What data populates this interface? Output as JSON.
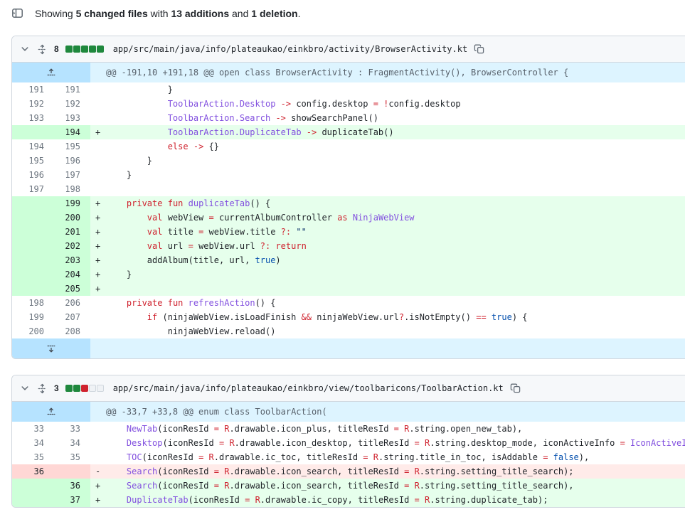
{
  "colors": {
    "border": "#d0d7de",
    "header_bg": "#f6f8fa",
    "add_line_bg": "#e6ffec",
    "add_gutter_bg": "#ccffd8",
    "del_line_bg": "#ffebe9",
    "del_gutter_bg": "#ffd7d5",
    "hunk_line_bg": "#ddf4ff",
    "hunk_gutter_bg": "#b6e3ff",
    "keyword": "#cf222e",
    "entity": "#8250df",
    "constant": "#0550ae",
    "string": "#0a3069",
    "diffstat_add": "#1f883d",
    "diffstat_del": "#cf222e"
  },
  "icons": {
    "file_tree_toggle": "sidebar-expand",
    "chevron": "chevron-down",
    "reorder": "unfold-vertical-arrows",
    "copy": "copy",
    "expand_up": "fold-up-arrow-with-dashes",
    "expand_down": "fold-down-arrow-with-dashes"
  },
  "summary": {
    "segments": [
      {
        "text": "Showing ",
        "bold": false
      },
      {
        "text": "5 changed files",
        "bold": true
      },
      {
        "text": " with ",
        "bold": false
      },
      {
        "text": "13 additions",
        "bold": true
      },
      {
        "text": " and ",
        "bold": false
      },
      {
        "text": "1 deletion",
        "bold": true
      },
      {
        "text": ".",
        "bold": false
      }
    ]
  },
  "files": [
    {
      "count": "8",
      "diffstat": [
        "add",
        "add",
        "add",
        "add",
        "add"
      ],
      "path": "app/src/main/java/info/plateaukao/einkbro/activity/BrowserActivity.kt",
      "hunk": "@@ -191,10 +191,18 @@ open class BrowserActivity : FragmentActivity(), BrowserController {",
      "expand_bottom": true,
      "rows": [
        {
          "t": "context",
          "old": "191",
          "new": "191",
          "seg": [
            [
              "p",
              "            }"
            ]
          ]
        },
        {
          "t": "context",
          "old": "192",
          "new": "192",
          "seg": [
            [
              "p",
              "            "
            ],
            [
              "e",
              "ToolbarAction.Desktop"
            ],
            [
              "p",
              " "
            ],
            [
              "k",
              "->"
            ],
            [
              "p",
              " config.desktop "
            ],
            [
              "k",
              "="
            ],
            [
              "p",
              " "
            ],
            [
              "k",
              "!"
            ],
            [
              "p",
              "config.desktop"
            ]
          ]
        },
        {
          "t": "context",
          "old": "193",
          "new": "193",
          "seg": [
            [
              "p",
              "            "
            ],
            [
              "e",
              "ToolbarAction.Search"
            ],
            [
              "p",
              " "
            ],
            [
              "k",
              "->"
            ],
            [
              "p",
              " showSearchPanel()"
            ]
          ]
        },
        {
          "t": "add",
          "old": "",
          "new": "194",
          "seg": [
            [
              "p",
              "            "
            ],
            [
              "e",
              "ToolbarAction.DuplicateTab"
            ],
            [
              "p",
              " "
            ],
            [
              "k",
              "->"
            ],
            [
              "p",
              " duplicateTab()"
            ]
          ]
        },
        {
          "t": "context",
          "old": "194",
          "new": "195",
          "seg": [
            [
              "p",
              "            "
            ],
            [
              "k",
              "else"
            ],
            [
              "p",
              " "
            ],
            [
              "k",
              "->"
            ],
            [
              "p",
              " {}"
            ]
          ]
        },
        {
          "t": "context",
          "old": "195",
          "new": "196",
          "seg": [
            [
              "p",
              "        }"
            ]
          ]
        },
        {
          "t": "context",
          "old": "196",
          "new": "197",
          "seg": [
            [
              "p",
              "    }"
            ]
          ]
        },
        {
          "t": "context",
          "old": "197",
          "new": "198",
          "seg": []
        },
        {
          "t": "add",
          "old": "",
          "new": "199",
          "seg": [
            [
              "p",
              "    "
            ],
            [
              "k",
              "private"
            ],
            [
              "p",
              " "
            ],
            [
              "k",
              "fun"
            ],
            [
              "p",
              " "
            ],
            [
              "e",
              "duplicateTab"
            ],
            [
              "p",
              "() {"
            ]
          ]
        },
        {
          "t": "add",
          "old": "",
          "new": "200",
          "seg": [
            [
              "p",
              "        "
            ],
            [
              "k",
              "val"
            ],
            [
              "p",
              " webView "
            ],
            [
              "k",
              "="
            ],
            [
              "p",
              " currentAlbumController "
            ],
            [
              "k",
              "as"
            ],
            [
              "p",
              " "
            ],
            [
              "e",
              "NinjaWebView"
            ]
          ]
        },
        {
          "t": "add",
          "old": "",
          "new": "201",
          "seg": [
            [
              "p",
              "        "
            ],
            [
              "k",
              "val"
            ],
            [
              "p",
              " title "
            ],
            [
              "k",
              "="
            ],
            [
              "p",
              " webView.title "
            ],
            [
              "k",
              "?:"
            ],
            [
              "p",
              " "
            ],
            [
              "s",
              "\"\""
            ]
          ]
        },
        {
          "t": "add",
          "old": "",
          "new": "202",
          "seg": [
            [
              "p",
              "        "
            ],
            [
              "k",
              "val"
            ],
            [
              "p",
              " url "
            ],
            [
              "k",
              "="
            ],
            [
              "p",
              " webView.url "
            ],
            [
              "k",
              "?:"
            ],
            [
              "p",
              " "
            ],
            [
              "k",
              "return"
            ]
          ]
        },
        {
          "t": "add",
          "old": "",
          "new": "203",
          "seg": [
            [
              "p",
              "        addAlbum(title, url, "
            ],
            [
              "c",
              "true"
            ],
            [
              "p",
              ")"
            ]
          ]
        },
        {
          "t": "add",
          "old": "",
          "new": "204",
          "seg": [
            [
              "p",
              "    }"
            ]
          ]
        },
        {
          "t": "add",
          "old": "",
          "new": "205",
          "seg": []
        },
        {
          "t": "context",
          "old": "198",
          "new": "206",
          "seg": [
            [
              "p",
              "    "
            ],
            [
              "k",
              "private"
            ],
            [
              "p",
              " "
            ],
            [
              "k",
              "fun"
            ],
            [
              "p",
              " "
            ],
            [
              "e",
              "refreshAction"
            ],
            [
              "p",
              "() {"
            ]
          ]
        },
        {
          "t": "context",
          "old": "199",
          "new": "207",
          "seg": [
            [
              "p",
              "        "
            ],
            [
              "k",
              "if"
            ],
            [
              "p",
              " (ninjaWebView.isLoadFinish "
            ],
            [
              "k",
              "&&"
            ],
            [
              "p",
              " ninjaWebView.url"
            ],
            [
              "k",
              "?"
            ],
            [
              "p",
              ".isNotEmpty() "
            ],
            [
              "k",
              "=="
            ],
            [
              "p",
              " "
            ],
            [
              "c",
              "true"
            ],
            [
              "p",
              ") {"
            ]
          ]
        },
        {
          "t": "context",
          "old": "200",
          "new": "208",
          "seg": [
            [
              "p",
              "            ninjaWebView.reload()"
            ]
          ]
        }
      ]
    },
    {
      "count": "3",
      "diffstat": [
        "add",
        "add",
        "del",
        "neutral",
        "neutral"
      ],
      "path": "app/src/main/java/info/plateaukao/einkbro/view/toolbaricons/ToolbarAction.kt",
      "hunk": "@@ -33,7 +33,8 @@ enum class ToolbarAction(",
      "expand_bottom": false,
      "rows": [
        {
          "t": "context",
          "old": "33",
          "new": "33",
          "seg": [
            [
              "p",
              "    "
            ],
            [
              "e",
              "NewTab"
            ],
            [
              "p",
              "(iconResId "
            ],
            [
              "k",
              "="
            ],
            [
              "p",
              " "
            ],
            [
              "k",
              "R"
            ],
            [
              "p",
              ".drawable.icon_plus, titleResId "
            ],
            [
              "k",
              "="
            ],
            [
              "p",
              " "
            ],
            [
              "k",
              "R"
            ],
            [
              "p",
              ".string.open_new_tab),"
            ]
          ]
        },
        {
          "t": "context",
          "old": "34",
          "new": "34",
          "seg": [
            [
              "p",
              "    "
            ],
            [
              "e",
              "Desktop"
            ],
            [
              "p",
              "(iconResId "
            ],
            [
              "k",
              "="
            ],
            [
              "p",
              " "
            ],
            [
              "k",
              "R"
            ],
            [
              "p",
              ".drawable.icon_desktop, titleResId "
            ],
            [
              "k",
              "="
            ],
            [
              "p",
              " "
            ],
            [
              "k",
              "R"
            ],
            [
              "p",
              ".string.desktop_mode, iconActiveInfo "
            ],
            [
              "k",
              "="
            ],
            [
              "p",
              " "
            ],
            [
              "e",
              "IconActiveIn"
            ]
          ]
        },
        {
          "t": "context",
          "old": "35",
          "new": "35",
          "seg": [
            [
              "p",
              "    "
            ],
            [
              "e",
              "TOC"
            ],
            [
              "p",
              "(iconResId "
            ],
            [
              "k",
              "="
            ],
            [
              "p",
              " "
            ],
            [
              "k",
              "R"
            ],
            [
              "p",
              ".drawable.ic_toc, titleResId "
            ],
            [
              "k",
              "="
            ],
            [
              "p",
              " "
            ],
            [
              "k",
              "R"
            ],
            [
              "p",
              ".string.title_in_toc, isAddable "
            ],
            [
              "k",
              "="
            ],
            [
              "p",
              " "
            ],
            [
              "c",
              "false"
            ],
            [
              "p",
              "),"
            ]
          ]
        },
        {
          "t": "del",
          "old": "36",
          "new": "",
          "seg": [
            [
              "p",
              "    "
            ],
            [
              "e",
              "Search"
            ],
            [
              "p",
              "(iconResId "
            ],
            [
              "k",
              "="
            ],
            [
              "p",
              " "
            ],
            [
              "k",
              "R"
            ],
            [
              "p",
              ".drawable.icon_search, titleResId "
            ],
            [
              "k",
              "="
            ],
            [
              "p",
              " "
            ],
            [
              "k",
              "R"
            ],
            [
              "p",
              ".string.setting_title_search);"
            ]
          ]
        },
        {
          "t": "add",
          "old": "",
          "new": "36",
          "seg": [
            [
              "p",
              "    "
            ],
            [
              "e",
              "Search"
            ],
            [
              "p",
              "(iconResId "
            ],
            [
              "k",
              "="
            ],
            [
              "p",
              " "
            ],
            [
              "k",
              "R"
            ],
            [
              "p",
              ".drawable.icon_search, titleResId "
            ],
            [
              "k",
              "="
            ],
            [
              "p",
              " "
            ],
            [
              "k",
              "R"
            ],
            [
              "p",
              ".string.setting_title_search),"
            ]
          ]
        },
        {
          "t": "add",
          "old": "",
          "new": "37",
          "seg": [
            [
              "p",
              "    "
            ],
            [
              "e",
              "DuplicateTab"
            ],
            [
              "p",
              "(iconResId "
            ],
            [
              "k",
              "="
            ],
            [
              "p",
              " "
            ],
            [
              "k",
              "R"
            ],
            [
              "p",
              ".drawable.ic_copy, titleResId "
            ],
            [
              "k",
              "="
            ],
            [
              "p",
              " "
            ],
            [
              "k",
              "R"
            ],
            [
              "p",
              ".string.duplicate_tab);"
            ]
          ]
        }
      ]
    }
  ]
}
